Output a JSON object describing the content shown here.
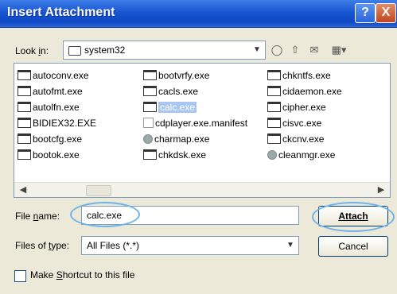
{
  "window": {
    "title": "Insert Attachment",
    "help_label": "?",
    "close_label": "X"
  },
  "look_in": {
    "label": "Look in:",
    "folder": "system32"
  },
  "files": [
    {
      "name": "autoconv.exe"
    },
    {
      "name": "autofmt.exe"
    },
    {
      "name": "autolfn.exe"
    },
    {
      "name": "BIDIEX32.EXE"
    },
    {
      "name": "bootcfg.exe"
    },
    {
      "name": "bootok.exe"
    },
    {
      "name": "bootvrfy.exe"
    },
    {
      "name": "cacls.exe"
    },
    {
      "name": "calc.exe"
    },
    {
      "name": "cdplayer.exe.manifest"
    },
    {
      "name": "charmap.exe"
    },
    {
      "name": "chkdsk.exe"
    },
    {
      "name": "chkntfs.exe"
    },
    {
      "name": "cidaemon.exe"
    },
    {
      "name": "cipher.exe"
    },
    {
      "name": "cisvc.exe"
    },
    {
      "name": "ckcnv.exe"
    },
    {
      "name": "cleanmgr.exe"
    }
  ],
  "file_name": {
    "label": "File name:",
    "value": "calc.exe"
  },
  "files_of_type": {
    "label": "Files of type:",
    "value": "All Files (*.*)"
  },
  "buttons": {
    "attach": "Attach",
    "cancel": "Cancel"
  },
  "shortcut": {
    "label": "Make Shortcut to this file"
  }
}
